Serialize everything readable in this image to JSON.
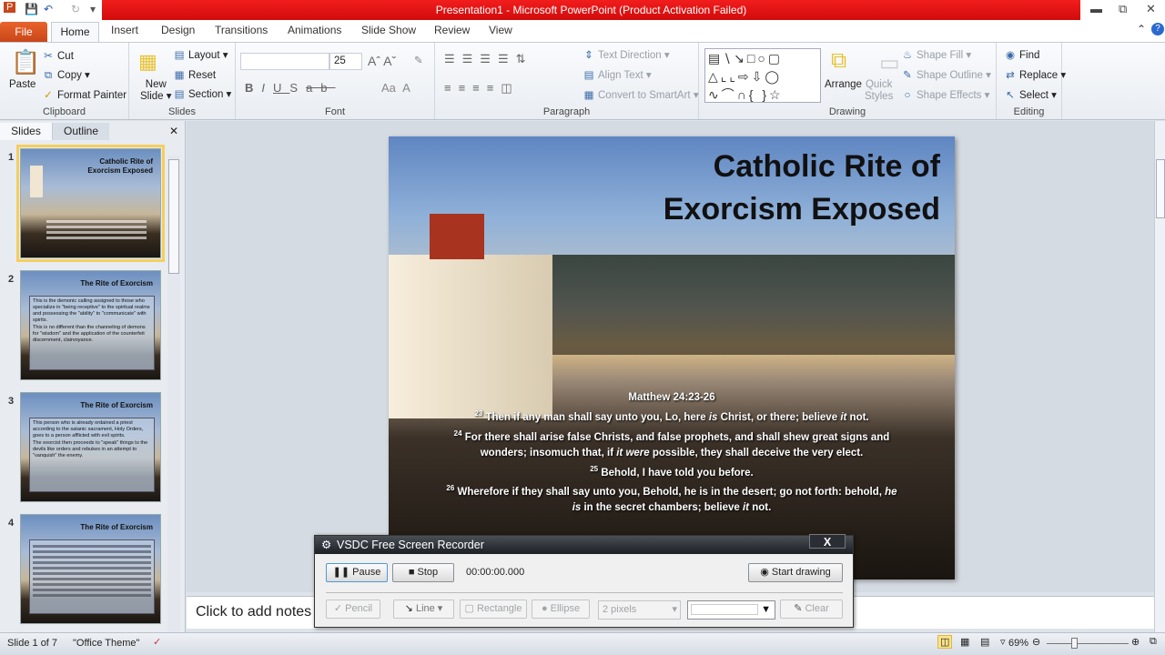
{
  "window": {
    "title": "Presentation1 - Microsoft PowerPoint (Product Activation Failed)"
  },
  "tabs": [
    "File",
    "Home",
    "Insert",
    "Design",
    "Transitions",
    "Animations",
    "Slide Show",
    "Review",
    "View"
  ],
  "ribbon": {
    "clipboard": {
      "label": "Clipboard",
      "paste": "Paste",
      "cut": "Cut",
      "copy": "Copy",
      "format_painter": "Format Painter"
    },
    "slides": {
      "label": "Slides",
      "new_slide_1": "New",
      "new_slide_2": "Slide",
      "layout": "Layout",
      "reset": "Reset",
      "section": "Section"
    },
    "font": {
      "label": "Font",
      "font_name": "",
      "font_size": "25"
    },
    "paragraph": {
      "label": "Paragraph",
      "text_direction": "Text Direction",
      "align_text": "Align Text",
      "convert_smartart": "Convert to SmartArt"
    },
    "drawing": {
      "label": "Drawing",
      "arrange": "Arrange",
      "quick_styles_1": "Quick",
      "quick_styles_2": "Styles",
      "shape_fill": "Shape Fill",
      "shape_outline": "Shape Outline",
      "shape_effects": "Shape Effects"
    },
    "editing": {
      "label": "Editing",
      "find": "Find",
      "replace": "Replace",
      "select": "Select"
    }
  },
  "pane": {
    "tabs": [
      "Slides",
      "Outline"
    ],
    "thumbs": [
      {
        "num": "1",
        "title": "Catholic  Rite of Exorcism Exposed"
      },
      {
        "num": "2",
        "title": "The Rite of Exorcism",
        "bullets": [
          "This is the demonic calling assigned to those who specialize in \"being receptive\" to the spiritual realms and possessing the \"ability\" to \"communicate\" with spirits.",
          "This is no different than the channeling of demons for \"wisdom\" and the application of the counterfeit discernment, clairvoyance."
        ]
      },
      {
        "num": "3",
        "title": "The Rite of Exorcism",
        "bullets": [
          "This person who is already ordained a priest according to the satanic sacrament, Holy Orders, goes to a person afflicted with evil spirits.",
          "The exorcist then proceeds to \"speak\" things to the devils like orders and rebukes in an attempt to \"vanquish\" the enemy."
        ]
      },
      {
        "num": "4",
        "title": "The Rite of Exorcism"
      }
    ]
  },
  "slide": {
    "title_1": "Catholic Rite of",
    "title_2": "Exorcism Exposed",
    "reference": "Matthew 24:23-26",
    "v23": {
      "n": "23",
      "a": "Then if any man shall  say unto you, Lo, here ",
      "b": "is",
      "c": " Christ, or there; believe ",
      "d": "it",
      "e": " not."
    },
    "v24": {
      "n": "24",
      "a": "For there shall arise false Christs, and false prophets, and shall shew great signs and wonders; insomuch that, if ",
      "b": "it  were",
      "c": " possible, they shall deceive the very elect."
    },
    "v25": {
      "n": "25",
      "a": "Behold, I  have told you before."
    },
    "v26": {
      "n": "26",
      "a": "Wherefore if they shall say unto you, Behold, he is in the desert; go not forth: behold, ",
      "b": "he is",
      "c": " in the secret chambers; believe ",
      "d": "it",
      "e": " not."
    }
  },
  "notes": {
    "placeholder": "Click to add notes"
  },
  "status": {
    "slide": "Slide 1 of 7",
    "theme": "\"Office Theme\"",
    "zoom": "69%",
    "zoom_value": 69
  },
  "recorder": {
    "title": "VSDC Free Screen Recorder",
    "pause": "Pause",
    "stop": "Stop",
    "time": "00:00:00.000",
    "start_drawing": "Start drawing",
    "pencil": "Pencil",
    "line": "Line",
    "rectangle": "Rectangle",
    "ellipse": "Ellipse",
    "pixels": "2 pixels",
    "clear": "Clear"
  }
}
